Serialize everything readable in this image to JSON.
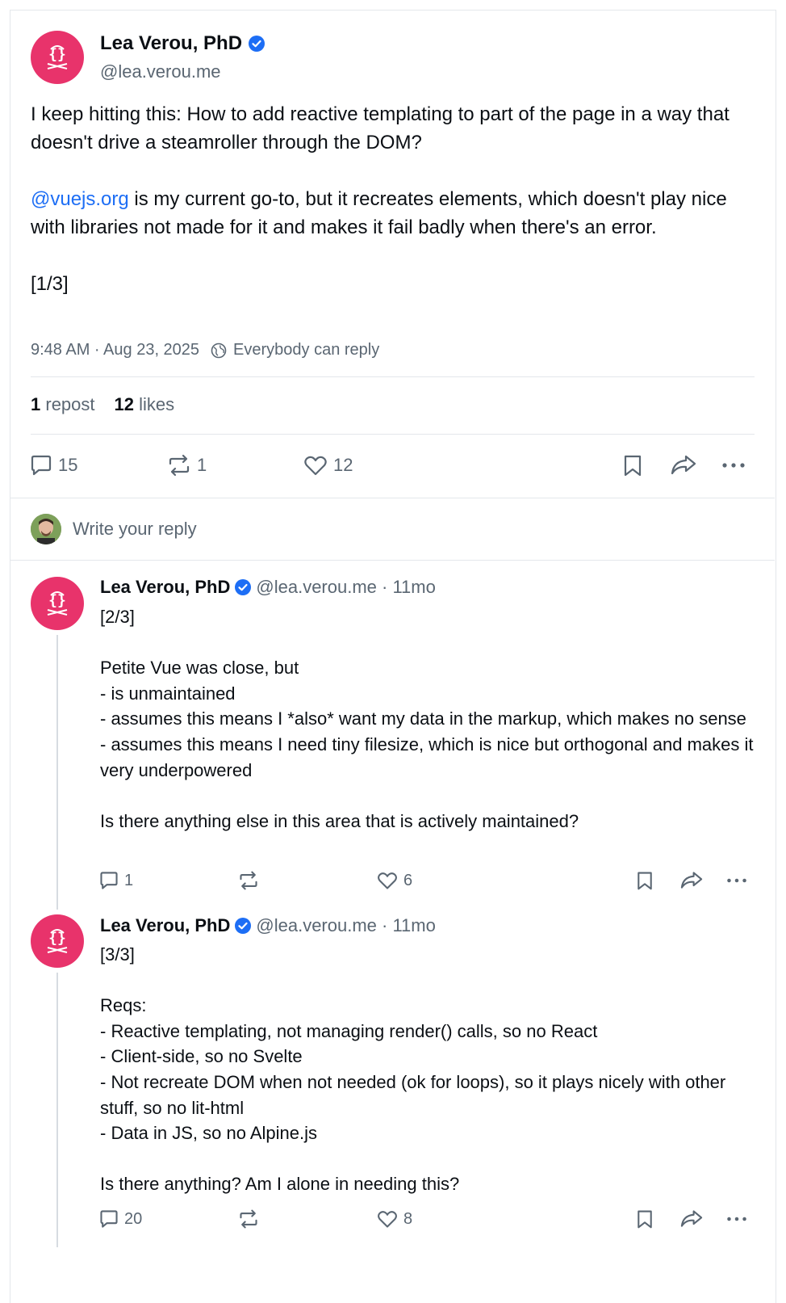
{
  "main_post": {
    "author_name": "Lea Verou, PhD",
    "handle": "@lea.verou.me",
    "text_line1": "I keep hitting this: How to add reactive templating to part of the page in a way that doesn't drive a steamroller through the DOM?",
    "mention": "@vuejs.org",
    "text_after_mention": " is my current go-to, but it recreates elements, which doesn't play nice with libraries not made for it and makes it fail badly when there's an error.",
    "counter": "[1/3]",
    "timestamp": "9:48 AM · Aug 23, 2025",
    "reply_setting": "Everybody can reply",
    "reposts_count": "1",
    "reposts_label": "repost",
    "likes_count": "12",
    "likes_label": "likes",
    "replies": "15",
    "reposts": "1",
    "likes": "12"
  },
  "composer": {
    "placeholder": "Write your reply"
  },
  "replies": [
    {
      "author_name": "Lea Verou, PhD",
      "handle": "@lea.verou.me · 11mo",
      "text": "[2/3]\n\nPetite Vue was close, but\n- is unmaintained\n- assumes this means I *also* want my data in the markup, which makes no sense\n- assumes this means I need tiny filesize, which is nice but orthogonal and makes it very underpowered\n\nIs there anything else in this area that is actively maintained?",
      "replies": "1",
      "likes": "6"
    },
    {
      "author_name": "Lea Verou, PhD",
      "handle": "@lea.verou.me · 11mo",
      "text": "[3/3]\n\nReqs:\n- Reactive templating, not managing render() calls, so no React\n- Client-side, so no Svelte\n- Not recreate DOM when not needed (ok for loops), so it plays nicely with other stuff, so no lit-html\n- Data in JS, so no Alpine.js\n\nIs there anything? Am I alone in needing this?",
      "replies": "20",
      "likes": "8"
    }
  ],
  "colors": {
    "avatar": "#e8336b",
    "link": "#1d6ef5",
    "verified": "#1d6ef5",
    "muted": "#5a6672"
  }
}
